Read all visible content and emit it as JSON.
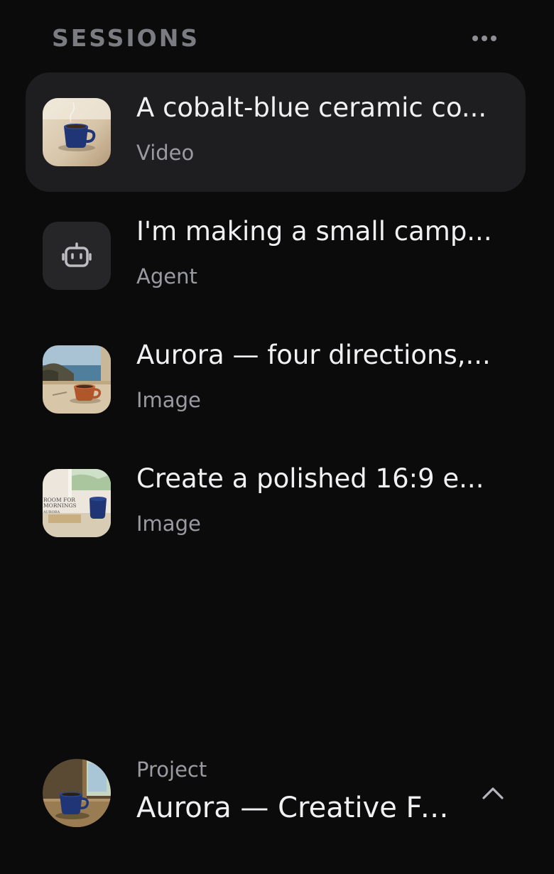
{
  "header": {
    "title": "SESSIONS",
    "more_icon": "more-horizontal-icon"
  },
  "sessions": [
    {
      "title": "A cobalt-blue ceramic co...",
      "type": "Video",
      "thumb": "coffee-cup-cobalt"
    },
    {
      "title": "I'm making a small camp...",
      "type": "Agent",
      "thumb": "robot-icon"
    },
    {
      "title": "Aurora — four directions,...",
      "type": "Image",
      "thumb": "coastal-window-cup"
    },
    {
      "title": "Create a polished 16:9 e...",
      "type": "Image",
      "thumb": "room-for-mornings-poster"
    }
  ],
  "thumb_text": {
    "line1": "ROOM FOR",
    "line2": "MORNINGS",
    "line3": "AURORA"
  },
  "project": {
    "label": "Project",
    "name": "Aurora — Creative Fi...",
    "chevron_icon": "chevron-up-icon"
  },
  "colors": {
    "background": "#0b0b0c",
    "active_row": "#1e1e20",
    "muted_text": "#9a9aa1",
    "primary_text": "#f1f1f3",
    "cobalt": "#1f3576"
  }
}
